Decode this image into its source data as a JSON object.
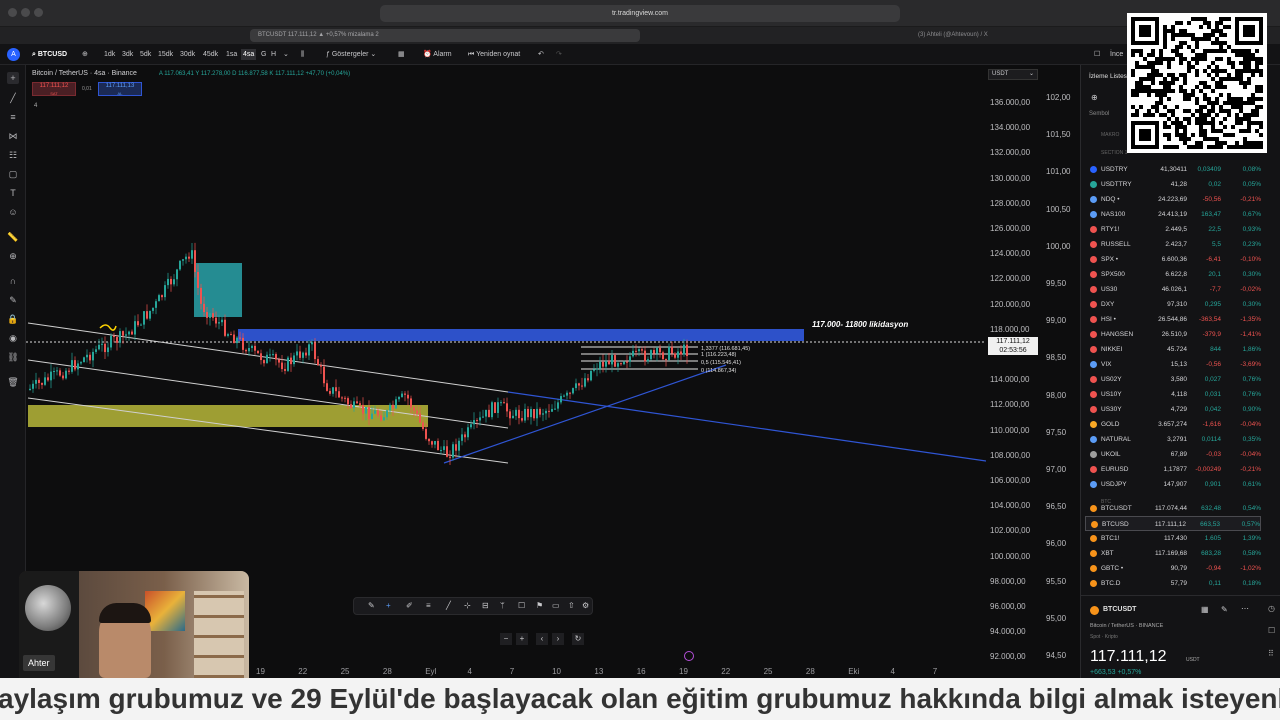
{
  "browser": {
    "url": "tr.tradingview.com",
    "tab_active": "BTCUSDT 117.111,12 ▲ +0,57% mizalama 2",
    "tab_other": "(3) Ahteli (@Ahtevoun) / X"
  },
  "toolbar": {
    "symbol": "BTCUSD",
    "intervals": [
      "1dk",
      "3dk",
      "5dk",
      "15dk",
      "30dk",
      "45dk",
      "1sa",
      "4sa",
      "G",
      "H"
    ],
    "indicators_label": "Göstergeler",
    "alarm_label": "Alarm",
    "replay_label": "Yeniden oynat",
    "right_label": "İnce"
  },
  "chart": {
    "title": "Bitcoin / TetherUS · 4sa · Binance",
    "ohlc": "A 117.063,41  Y 117.278,00  D 116.877,58  K 117.111,12  +47,70 (+0,04%)",
    "sell_price": "117.111,12",
    "sell_label": "SAT",
    "spread": "0,01",
    "buy_price": "117.111,13",
    "buy_label": "AL",
    "layers_count": "4",
    "currency": "USDT",
    "annotation": "117.000- 11800 likidasyon",
    "current_price": "117.111,12",
    "countdown": "02:53:56",
    "fib_levels": [
      "1,3377 (116.681,45)",
      "1 (116.223,48)",
      "0,5 (115.545,41)",
      "0 (114.867,34)"
    ],
    "price_axis": [
      "136.000,00",
      "134.000,00",
      "132.000,00",
      "130.000,00",
      "128.000,00",
      "126.000,00",
      "124.000,00",
      "122.000,00",
      "120.000,00",
      "118.000,00",
      "114.000,00",
      "112.000,00",
      "110.000,00",
      "108.000,00",
      "106.000,00",
      "104.000,00",
      "102.000,00",
      "100.000,00",
      "98.000,00",
      "96.000,00",
      "94.000,00",
      "92.000,00"
    ],
    "ratio_axis": [
      "102,00",
      "101,50",
      "101,00",
      "100,50",
      "100,00",
      "99,50",
      "99,00",
      "98,50",
      "98,00",
      "97,50",
      "97,00",
      "96,50",
      "96,00",
      "95,50",
      "95,00",
      "94,50"
    ],
    "time_axis": [
      "19",
      "22",
      "25",
      "28",
      "Eyl",
      "4",
      "7",
      "10",
      "13",
      "16",
      "19",
      "22",
      "25",
      "28",
      "Eki",
      "4",
      "7"
    ]
  },
  "watchlist": {
    "title": "İzleme Listesi",
    "search_label": "Sembol",
    "section_makro": "MAKRO",
    "section_1": "SECTION 1",
    "section_btc": "BTC",
    "rows": [
      {
        "sym": "USDTRY",
        "last": "41,30411",
        "chg": "0,03409",
        "pct": "0,08%",
        "dir": "up",
        "color": "#2962ff"
      },
      {
        "sym": "USDTTRY",
        "last": "41,28",
        "chg": "0,02",
        "pct": "0,05%",
        "dir": "up",
        "color": "#26a69a"
      },
      {
        "sym": "NDQ •",
        "last": "24.223,69",
        "chg": "-50,56",
        "pct": "-0,21%",
        "dir": "dn",
        "color": "#5b9cf6"
      },
      {
        "sym": "NAS100",
        "last": "24.413,19",
        "chg": "163,47",
        "pct": "0,67%",
        "dir": "up",
        "color": "#5b9cf6"
      },
      {
        "sym": "RTY1!",
        "last": "2.449,5",
        "chg": "22,5",
        "pct": "0,93%",
        "dir": "up",
        "color": "#ef5350"
      },
      {
        "sym": "RUSSELL",
        "last": "2.423,7",
        "chg": "5,5",
        "pct": "0,23%",
        "dir": "up",
        "color": "#ef5350"
      },
      {
        "sym": "SPX •",
        "last": "6.600,36",
        "chg": "-6,41",
        "pct": "-0,10%",
        "dir": "dn",
        "color": "#ef5350"
      },
      {
        "sym": "SPX500",
        "last": "6.622,8",
        "chg": "20,1",
        "pct": "0,30%",
        "dir": "up",
        "color": "#ef5350"
      },
      {
        "sym": "US30",
        "last": "46.026,1",
        "chg": "-7,7",
        "pct": "-0,02%",
        "dir": "dn",
        "color": "#ef5350"
      },
      {
        "sym": "DXY",
        "last": "97,310",
        "chg": "0,295",
        "pct": "0,30%",
        "dir": "up",
        "color": "#ef5350"
      },
      {
        "sym": "HSI •",
        "last": "26.544,86",
        "chg": "-363,54",
        "pct": "-1,35%",
        "dir": "dn",
        "color": "#ef5350"
      },
      {
        "sym": "HANGSEN",
        "last": "26.510,9",
        "chg": "-379,9",
        "pct": "-1,41%",
        "dir": "dn",
        "color": "#ef5350"
      },
      {
        "sym": "NIKKEI",
        "last": "45.724",
        "chg": "844",
        "pct": "1,86%",
        "dir": "up",
        "color": "#ef5350"
      },
      {
        "sym": "VIX",
        "last": "15,13",
        "chg": "-0,56",
        "pct": "-3,69%",
        "dir": "dn",
        "color": "#5b9cf6"
      },
      {
        "sym": "US02Y",
        "last": "3,580",
        "chg": "0,027",
        "pct": "0,76%",
        "dir": "up",
        "color": "#ef5350"
      },
      {
        "sym": "US10Y",
        "last": "4,118",
        "chg": "0,031",
        "pct": "0,76%",
        "dir": "up",
        "color": "#ef5350"
      },
      {
        "sym": "US30Y",
        "last": "4,729",
        "chg": "0,042",
        "pct": "0,90%",
        "dir": "up",
        "color": "#ef5350"
      },
      {
        "sym": "GOLD",
        "last": "3.657,274",
        "chg": "-1,616",
        "pct": "-0,04%",
        "dir": "dn",
        "color": "#f9a825"
      },
      {
        "sym": "NATURAL",
        "last": "3,2791",
        "chg": "0,0114",
        "pct": "0,35%",
        "dir": "up",
        "color": "#5b9cf6"
      },
      {
        "sym": "UKOIL",
        "last": "67,89",
        "chg": "-0,03",
        "pct": "-0,04%",
        "dir": "dn",
        "color": "#9e9e9e"
      },
      {
        "sym": "EURUSD",
        "last": "1,17877",
        "chg": "-0,00249",
        "pct": "-0,21%",
        "dir": "dn",
        "color": "#ef5350"
      },
      {
        "sym": "USDJPY",
        "last": "147,907",
        "chg": "0,901",
        "pct": "0,61%",
        "dir": "up",
        "color": "#5b9cf6"
      },
      {
        "sym": "BTCUSDT",
        "last": "117.074,44",
        "chg": "632,48",
        "pct": "0,54%",
        "dir": "up",
        "color": "#f7931a"
      },
      {
        "sym": "BTCUSD",
        "last": "117.111,12",
        "chg": "663,53",
        "pct": "0,57%",
        "dir": "up",
        "color": "#f7931a"
      },
      {
        "sym": "BTC1!",
        "last": "117.430",
        "chg": "1.605",
        "pct": "1,39%",
        "dir": "up",
        "color": "#f7931a"
      },
      {
        "sym": "XBT",
        "last": "117.169,68",
        "chg": "683,28",
        "pct": "0,58%",
        "dir": "up",
        "color": "#f7931a"
      },
      {
        "sym": "GBTC •",
        "last": "90,79",
        "chg": "-0,94",
        "pct": "-1,02%",
        "dir": "dn",
        "color": "#f7931a"
      },
      {
        "sym": "BTC.D",
        "last": "57,79",
        "chg": "0,11",
        "pct": "0,18%",
        "dir": "up",
        "color": "#f7931a"
      }
    ],
    "detail_symbol": "BTCUSDT",
    "detail_name": "Bitcoin / TetherUS",
    "detail_exchange": "BINANCE",
    "detail_type": "Spot · Kripto",
    "detail_price": "117.111,12",
    "detail_currency": "USDT",
    "detail_change": "+663,53 +0,57%"
  },
  "webcam": {
    "name_label": "Ahter"
  },
  "caption": {
    "text": "aylaşım grubumuz ve 29 Eylül'de başlayacak olan eğitim grubumuz hakkında bilgi almak isteyenler bizlere u"
  }
}
